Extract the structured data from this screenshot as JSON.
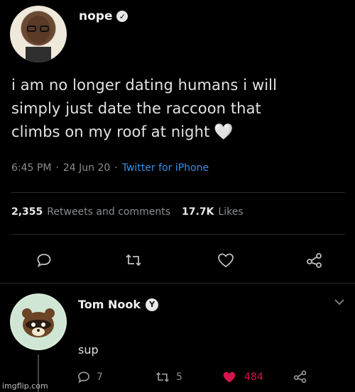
{
  "tweet": {
    "author_name": "nope",
    "text_lines": [
      "i am no longer dating humans i will",
      "simply just date the raccoon that",
      "climbs on my roof at night"
    ],
    "heart_emoji": "🤍",
    "time": "6:45 PM",
    "date": "24 Jun 20",
    "source": "Twitter for iPhone",
    "retweets_count": "2,355",
    "retweets_label": "Retweets and comments",
    "likes_count": "17.7K",
    "likes_label": "Likes"
  },
  "reply": {
    "author_name": "Tom Nook",
    "badge": "Y",
    "text": "sup",
    "reply_count": "7",
    "retweet_count": "5",
    "like_count": "484"
  },
  "watermark": "imgflip.com",
  "colors": {
    "background": "#000000",
    "link": "#3b8fe0",
    "liked": "#d5134d"
  },
  "icons": [
    "verified-icon",
    "reply-icon",
    "retweet-icon",
    "like-icon",
    "share-icon",
    "chevron-down-icon"
  ]
}
